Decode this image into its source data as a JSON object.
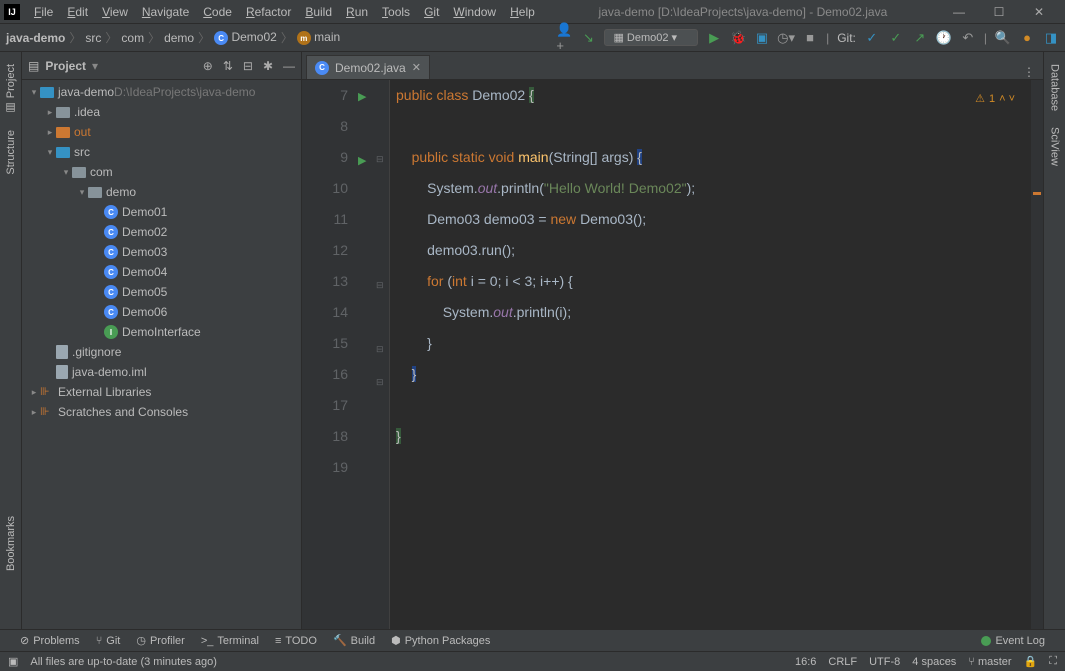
{
  "title": "java-demo [D:\\IdeaProjects\\java-demo] - Demo02.java",
  "menu": [
    "File",
    "Edit",
    "View",
    "Navigate",
    "Code",
    "Refactor",
    "Build",
    "Run",
    "Tools",
    "Git",
    "Window",
    "Help"
  ],
  "breadcrumb": [
    {
      "label": "java-demo",
      "type": "proj"
    },
    {
      "label": "src",
      "type": "folder"
    },
    {
      "label": "com",
      "type": "folder"
    },
    {
      "label": "demo",
      "type": "folder"
    },
    {
      "label": "Demo02",
      "type": "class"
    },
    {
      "label": "main",
      "type": "method"
    }
  ],
  "run_config": "Demo02",
  "git_label": "Git:",
  "left_tabs": [
    "Project",
    "Structure",
    "Bookmarks"
  ],
  "right_tabs": [
    "Database",
    "SciView"
  ],
  "project_panel_title": "Project",
  "tree": {
    "root_label": "java-demo",
    "root_path": "D:\\IdeaProjects\\java-demo",
    "items": [
      {
        "depth": 0,
        "tw": "v",
        "icon": "folder-src",
        "label": "java-demo",
        "extra": "D:\\IdeaProjects\\java-demo"
      },
      {
        "depth": 1,
        "tw": ">",
        "icon": "folder",
        "label": ".idea"
      },
      {
        "depth": 1,
        "tw": ">",
        "icon": "folder-out",
        "label": "out"
      },
      {
        "depth": 1,
        "tw": "v",
        "icon": "folder-src",
        "label": "src"
      },
      {
        "depth": 2,
        "tw": "v",
        "icon": "folder",
        "label": "com"
      },
      {
        "depth": 3,
        "tw": "v",
        "icon": "folder",
        "label": "demo"
      },
      {
        "depth": 4,
        "tw": "",
        "icon": "class",
        "label": "Demo01"
      },
      {
        "depth": 4,
        "tw": "",
        "icon": "class",
        "label": "Demo02"
      },
      {
        "depth": 4,
        "tw": "",
        "icon": "class",
        "label": "Demo03"
      },
      {
        "depth": 4,
        "tw": "",
        "icon": "class",
        "label": "Demo04"
      },
      {
        "depth": 4,
        "tw": "",
        "icon": "class",
        "label": "Demo05"
      },
      {
        "depth": 4,
        "tw": "",
        "icon": "class",
        "label": "Demo06"
      },
      {
        "depth": 4,
        "tw": "",
        "icon": "iface",
        "label": "DemoInterface"
      },
      {
        "depth": 1,
        "tw": "",
        "icon": "file",
        "label": ".gitignore"
      },
      {
        "depth": 1,
        "tw": "",
        "icon": "file",
        "label": "java-demo.iml"
      },
      {
        "depth": 0,
        "tw": ">",
        "icon": "lib",
        "label": "External Libraries"
      },
      {
        "depth": 0,
        "tw": ">",
        "icon": "lib",
        "label": "Scratches and Consoles"
      }
    ]
  },
  "editor_tab": "Demo02.java",
  "warn_count": "1",
  "code_lines": [
    {
      "n": 7,
      "run": true,
      "fold": "",
      "tokens": [
        [
          "",
          "kw",
          "public"
        ],
        [
          " ",
          "kw",
          "class"
        ],
        [
          " ",
          "ident",
          "Demo02 "
        ],
        [
          "",
          "match-hl",
          "{"
        ]
      ]
    },
    {
      "n": 8,
      "tokens": []
    },
    {
      "n": 9,
      "run": true,
      "fold": "-",
      "tokens": [
        [
          "    ",
          "kw",
          "public"
        ],
        [
          " ",
          "kw",
          "static"
        ],
        [
          " ",
          "kw",
          "void"
        ],
        [
          " ",
          "method",
          "main"
        ],
        [
          "",
          "ident",
          "(String[] args) "
        ],
        [
          "",
          "caret-hl",
          "{"
        ]
      ]
    },
    {
      "n": 10,
      "tokens": [
        [
          "        ",
          "ident",
          "System."
        ],
        [
          "",
          "field",
          "out"
        ],
        [
          "",
          "ident",
          ".println("
        ],
        [
          "",
          "str",
          "\"Hello World! Demo02\""
        ],
        [
          "",
          "ident",
          ");"
        ]
      ]
    },
    {
      "n": 11,
      "tokens": [
        [
          "        ",
          "ident",
          "Demo03 demo03 = "
        ],
        [
          "",
          "kw",
          "new"
        ],
        [
          " ",
          "ident",
          "Demo03();"
        ]
      ]
    },
    {
      "n": 12,
      "tokens": [
        [
          "        ",
          "ident",
          "demo03.run();"
        ]
      ]
    },
    {
      "n": 13,
      "fold": "-",
      "tokens": [
        [
          "        ",
          "kw",
          "for"
        ],
        [
          " ",
          "ident",
          "("
        ],
        [
          "",
          "kw",
          "int"
        ],
        [
          " ",
          "ident",
          "i = "
        ],
        [
          "",
          "ident",
          "0"
        ],
        [
          "",
          "ident",
          "; i < "
        ],
        [
          "",
          "ident",
          "3"
        ],
        [
          "",
          "ident",
          "; i++) {"
        ]
      ]
    },
    {
      "n": 14,
      "tokens": [
        [
          "            ",
          "ident",
          "System."
        ],
        [
          "",
          "field",
          "out"
        ],
        [
          "",
          "ident",
          ".println(i);"
        ]
      ]
    },
    {
      "n": 15,
      "fold": "-",
      "tokens": [
        [
          "        ",
          "ident",
          "}"
        ]
      ]
    },
    {
      "n": 16,
      "fold": "-",
      "tokens": [
        [
          "    ",
          "caret-hl",
          "}"
        ]
      ]
    },
    {
      "n": 17,
      "tokens": []
    },
    {
      "n": 18,
      "tokens": [
        [
          "",
          "match-hl",
          "}"
        ]
      ]
    },
    {
      "n": 19,
      "tokens": []
    }
  ],
  "bottom_tabs": [
    {
      "icon": "⊘",
      "label": "Problems"
    },
    {
      "icon": "⑂",
      "label": "Git"
    },
    {
      "icon": "◷",
      "label": "Profiler"
    },
    {
      "icon": ">_",
      "label": "Terminal"
    },
    {
      "icon": "≡",
      "label": "TODO"
    },
    {
      "icon": "🔨",
      "label": "Build"
    },
    {
      "icon": "⬢",
      "label": "Python Packages"
    }
  ],
  "event_log": "Event Log",
  "status_msg": "All files are up-to-date (3 minutes ago)",
  "status_right": {
    "pos": "16:6",
    "le": "CRLF",
    "enc": "UTF-8",
    "indent": "4 spaces",
    "branch": "master"
  }
}
